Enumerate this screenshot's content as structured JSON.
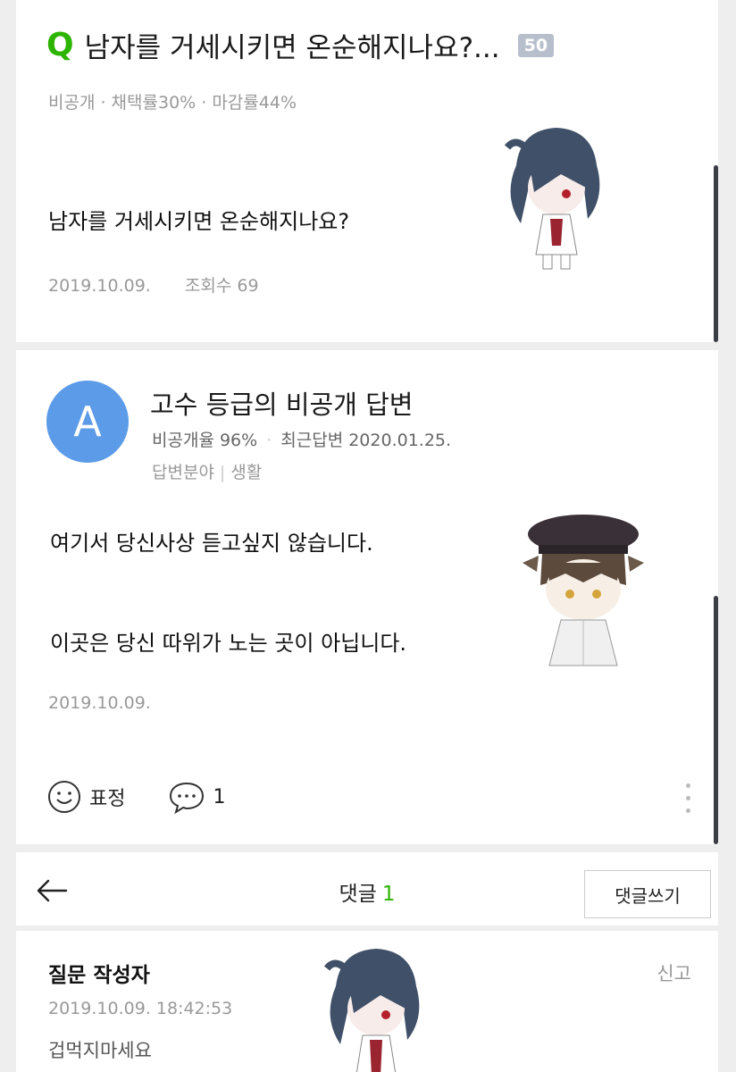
{
  "question": {
    "letter": "Q",
    "title": "남자를 거세시키면 온순해지나요?...",
    "badge": "50",
    "meta": "비공개 · 채택률30% · 마감률44%",
    "body": "남자를 거세시키면 온순해지나요?",
    "date": "2019.10.09.",
    "views": "조회수 69"
  },
  "answer": {
    "avatar_letter": "A",
    "name": "고수 등급의 비공개 답변",
    "private_rate": "비공개율 96%",
    "recent": "최근답변 2020.01.25.",
    "field_label": "답변분야",
    "field_value": "생활",
    "lines": [
      "여기서 당신사상 듣고싶지 않습니다.",
      "이곳은 당신 따위가 노는 곳이 아닙니다."
    ],
    "date": "2019.10.09.",
    "reaction_label": "표정",
    "comment_count": "1"
  },
  "comments": {
    "title": "댓글",
    "count": "1",
    "write_label": "댓글쓰기",
    "item": {
      "author": "질문 작성자",
      "report": "신고",
      "time": "2019.10.09. 18:42:53",
      "text": "겁먹지마세요"
    }
  },
  "icons": [
    "q-icon",
    "smile-icon",
    "speech-bubble-icon",
    "more-vertical-icon",
    "back-arrow-icon"
  ],
  "colors": {
    "accent_green": "#2db400",
    "avatar_blue": "#5b9be8",
    "badge_gray": "#b8bfcc"
  }
}
